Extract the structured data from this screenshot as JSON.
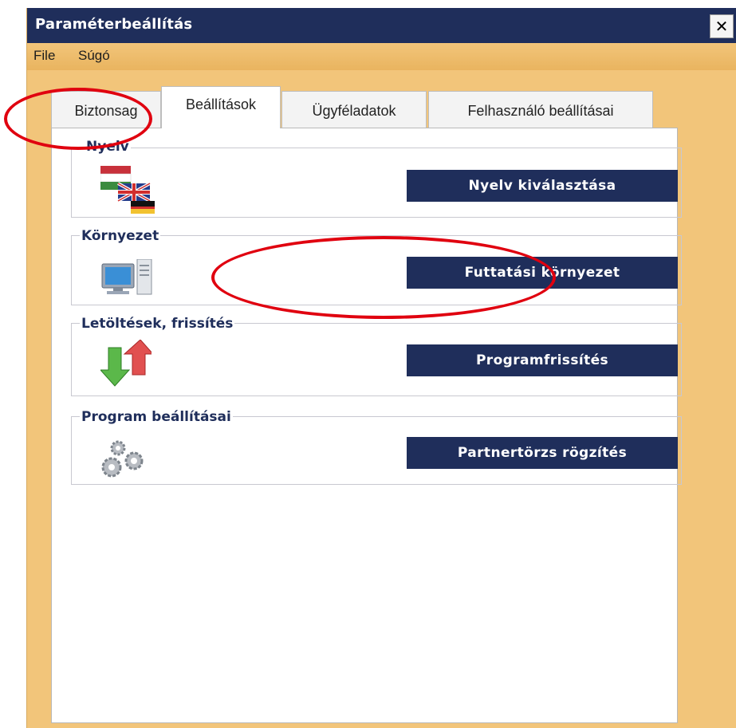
{
  "window": {
    "title": "Paraméterbeállítás",
    "close_label": "✕"
  },
  "menu": {
    "items": [
      "File",
      "Súgó"
    ]
  },
  "tabs": [
    {
      "label": "Biztonsag",
      "active": false
    },
    {
      "label": "Beállítások",
      "active": true
    },
    {
      "label": "Ügyféladatok",
      "active": false
    },
    {
      "label": "Felhasználó beállításai",
      "active": false
    }
  ],
  "groups": [
    {
      "label": "Nyelv",
      "button": "Nyelv kiválasztása",
      "icon": "flags-icon"
    },
    {
      "label": "Környezet",
      "button": "Futtatási környezet",
      "icon": "computer-icon"
    },
    {
      "label": "Letöltések, frissítés",
      "button": "Programfrissítés",
      "icon": "update-arrows-icon"
    },
    {
      "label": "Program beállításai",
      "button": "Partnertörzs rögzítés",
      "icon": "gears-icon"
    }
  ],
  "colors": {
    "titlebar": "#1f2e5b",
    "menubar": "#f2c57a",
    "button": "#1f2e5b",
    "annotation": "#e0000f"
  }
}
